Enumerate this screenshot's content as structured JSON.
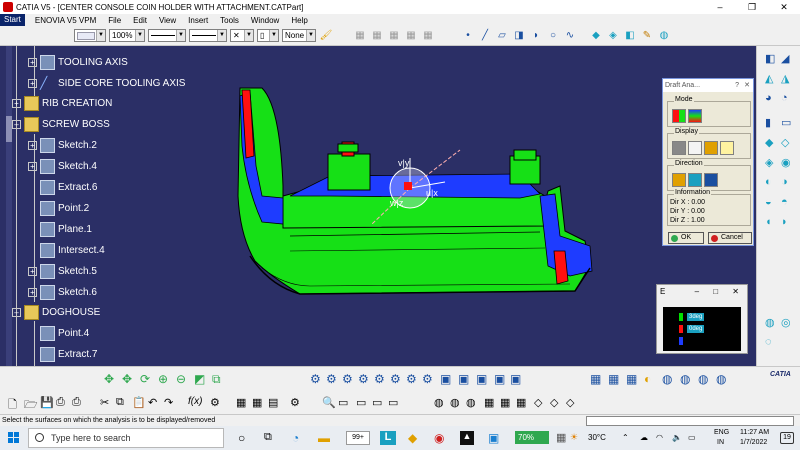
{
  "window": {
    "title": "CATIA V5 - [CENTER CONSOLE COIN HOLDER WITH ATTACHMENT.CATPart]",
    "min": "–",
    "max": "❐",
    "close": "✕"
  },
  "menu": {
    "start": "Start",
    "items": [
      "ENOVIA V5 VPM",
      "File",
      "Edit",
      "View",
      "Insert",
      "Tools",
      "Window",
      "Help"
    ]
  },
  "toolbar": {
    "zoom": "100%",
    "layer": "None"
  },
  "tree": {
    "nodes": [
      {
        "label": "TOOLING AXIS",
        "icon": "axis-system-icon"
      },
      {
        "label": "SIDE CORE TOOLING AXIS",
        "icon": "axis-line-icon"
      },
      {
        "label": "RIB CREATION",
        "icon": "geometrical-set-icon"
      },
      {
        "label": "SCREW BOSS",
        "icon": "geometrical-set-icon"
      },
      {
        "label": "Sketch.2",
        "icon": "sketch-icon"
      },
      {
        "label": "Sketch.4",
        "icon": "sketch-icon"
      },
      {
        "label": "Extract.6",
        "icon": "extract-icon"
      },
      {
        "label": "Point.2",
        "icon": "point-icon"
      },
      {
        "label": "Plane.1",
        "icon": "plane-icon"
      },
      {
        "label": "Intersect.4",
        "icon": "intersect-icon"
      },
      {
        "label": "Sketch.5",
        "icon": "sketch-icon"
      },
      {
        "label": "Sketch.6",
        "icon": "sketch-icon"
      },
      {
        "label": "DOGHOUSE",
        "icon": "geometrical-set-icon"
      },
      {
        "label": "Point.4",
        "icon": "point-icon"
      },
      {
        "label": "Extract.7",
        "icon": "extract-icon"
      }
    ]
  },
  "compass": {
    "v": "v|y",
    "u": "u|x",
    "w": "w|z"
  },
  "draft_dialog": {
    "title": "Draft Ana...",
    "help": "?",
    "close": "✕",
    "mode_label": "Mode",
    "display_label": "Display",
    "direction_label": "Direction",
    "information_label": "Information",
    "dir_x": "Dir X : 0.00",
    "dir_y": "Dir Y : 0.00",
    "dir_z": "Dir Z : 1.00",
    "ok": "OK",
    "cancel": "Cancel"
  },
  "legend_window": {
    "title": "E",
    "buttons": "– □ ✕",
    "entries": [
      {
        "color": "#00e000",
        "label": "3deg"
      },
      {
        "color": "#ff1010",
        "label": "0deg"
      },
      {
        "color": "#1e3cff",
        "label": ""
      }
    ]
  },
  "status": {
    "message": "Select the surfaces on which the analysis is to be displayed/removed"
  },
  "taskbar": {
    "search_placeholder": "Type here to search",
    "badge": "99+",
    "battery": "70%",
    "temperature": "30°C",
    "lang1": "ENG",
    "lang2": "IN",
    "time": "11:27 AM",
    "date": "1/7/2022",
    "notifications": "19"
  },
  "brand": {
    "logo_text": "CATIA"
  },
  "colors": {
    "viewport_bg": "#2b2f66",
    "draft_ok": "#00e000",
    "draft_bad": "#ff1010",
    "draft_neutral": "#1e3cff"
  }
}
